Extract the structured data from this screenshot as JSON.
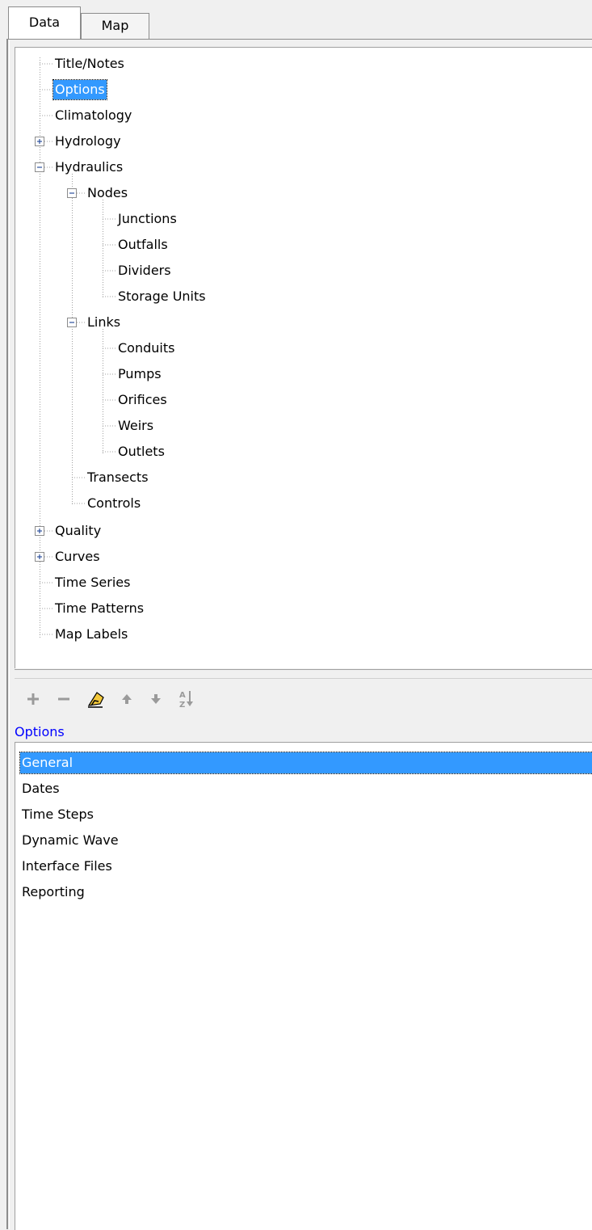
{
  "tabs": [
    {
      "label": "Data",
      "active": true
    },
    {
      "label": "Map",
      "active": false
    }
  ],
  "tree": {
    "title_notes": "Title/Notes",
    "options": "Options",
    "climatology": "Climatology",
    "hydrology": "Hydrology",
    "hydraulics": "Hydraulics",
    "nodes": "Nodes",
    "junctions": "Junctions",
    "outfalls": "Outfalls",
    "dividers": "Dividers",
    "storage_units": "Storage Units",
    "links": "Links",
    "conduits": "Conduits",
    "pumps": "Pumps",
    "orifices": "Orifices",
    "weirs": "Weirs",
    "outlets": "Outlets",
    "transects": "Transects",
    "controls": "Controls",
    "quality": "Quality",
    "curves": "Curves",
    "time_series": "Time Series",
    "time_patterns": "Time Patterns",
    "map_labels": "Map Labels",
    "selected": "Options"
  },
  "toolbar": {
    "add_icon": "plus-icon",
    "delete_icon": "minus-icon",
    "edit_icon": "edit-hand-icon",
    "up_icon": "arrow-up-icon",
    "down_icon": "arrow-down-icon",
    "sort_icon": "sort-az-icon"
  },
  "items_label": "Options",
  "items": [
    "General",
    "Dates",
    "Time Steps",
    "Dynamic Wave",
    "Interface Files",
    "Reporting"
  ],
  "selected_item": "General",
  "colors": {
    "selection": "#3399ff",
    "section_label": "#0000ff",
    "icon_gray": "#9a9a9a"
  }
}
